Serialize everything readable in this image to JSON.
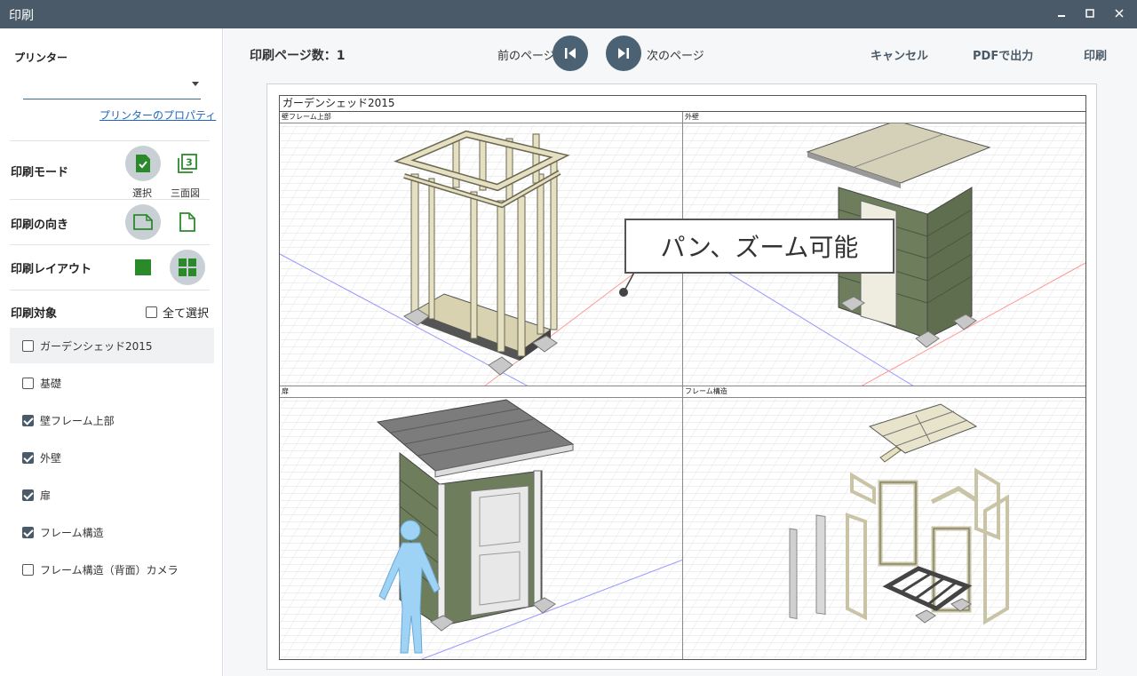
{
  "window": {
    "title": "印刷"
  },
  "printer": {
    "label": "プリンター",
    "value": "",
    "properties_link": "プリンターのプロパティ"
  },
  "print_mode": {
    "label": "印刷モード",
    "options": [
      {
        "caption": "選択"
      },
      {
        "caption": "三面図"
      }
    ]
  },
  "orientation": {
    "label": "印刷の向き"
  },
  "layout": {
    "label": "印刷レイアウト"
  },
  "targets": {
    "label": "印刷対象",
    "select_all": "全て選択",
    "items": [
      {
        "label": "ガーデンシェッド2015",
        "checked": false
      },
      {
        "label": "基礎",
        "checked": false
      },
      {
        "label": "壁フレーム上部",
        "checked": true
      },
      {
        "label": "外壁",
        "checked": true
      },
      {
        "label": "扉",
        "checked": true
      },
      {
        "label": "フレーム構造",
        "checked": true
      },
      {
        "label": "フレーム構造（背面）カメラ",
        "checked": false
      }
    ]
  },
  "toolbar": {
    "page_count_label": "印刷ページ数：1",
    "prev_label": "前のページ",
    "next_label": "次のページ",
    "cancel": "キャンセル",
    "pdf": "PDFで出力",
    "print": "印刷"
  },
  "preview": {
    "title": "ガーデンシェッド2015",
    "views": [
      "壁フレーム上部",
      "外壁",
      "扉",
      "フレーム構造"
    ],
    "callout": "パン、ズーム可能"
  },
  "colors": {
    "titlebar": "#4a5a68",
    "accent_green": "#2a8a2a",
    "nav_button": "#4a6274",
    "link": "#2266bb"
  }
}
